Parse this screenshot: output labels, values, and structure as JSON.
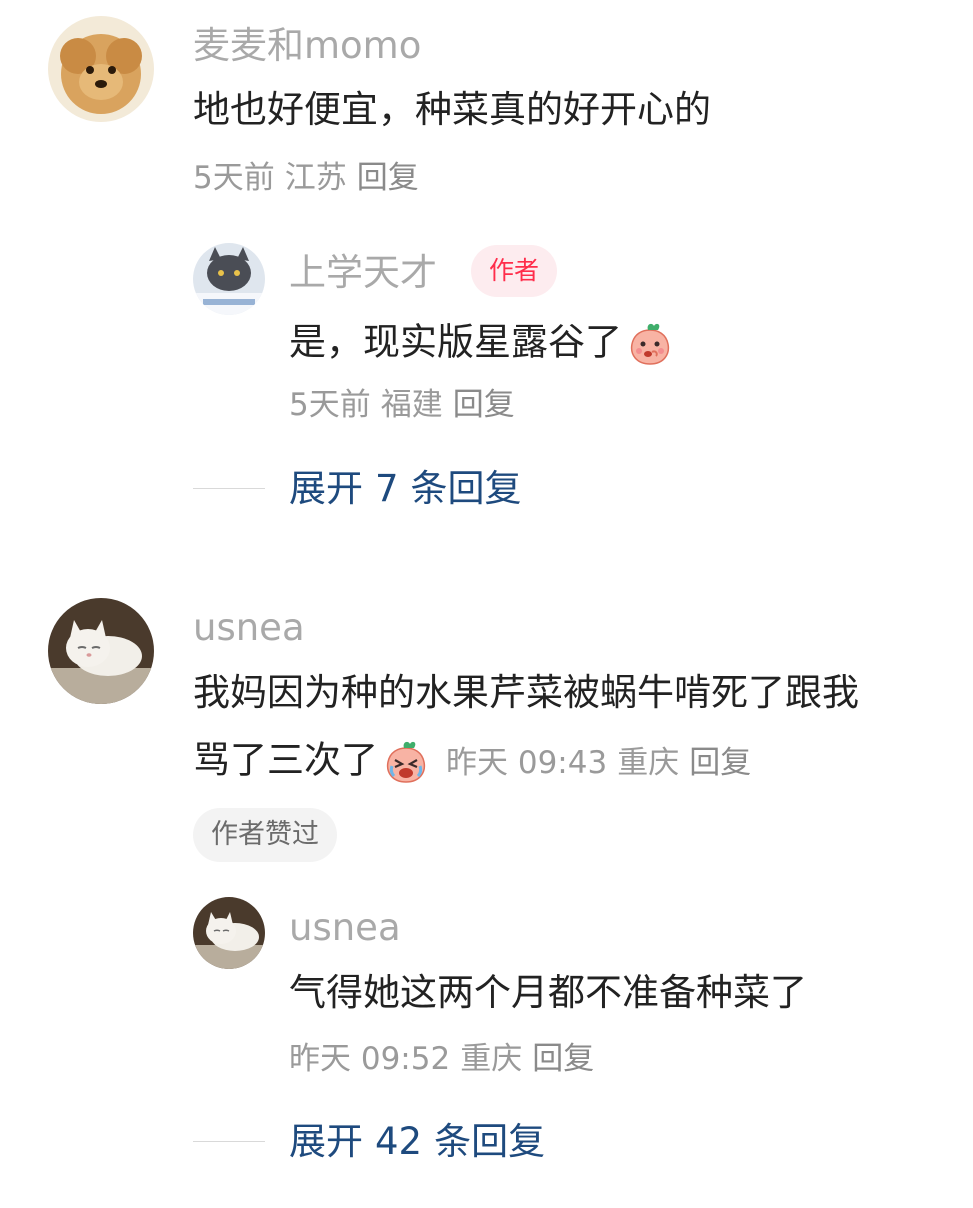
{
  "comments": [
    {
      "username": "麦麦和momo",
      "text": "地也好便宜，种菜真的好开心的",
      "time": "5天前",
      "location": "江苏",
      "reply_label": "回复",
      "avatar_icon": "dog-avatar",
      "reply": {
        "username": "上学天才",
        "badge": "作者",
        "text": "是，现实版星露谷了",
        "emoji_icon": "peach-smile-emoji",
        "time": "5天前",
        "location": "福建",
        "reply_label": "回复",
        "avatar_icon": "cat-avatar"
      },
      "expand": {
        "prefix": "展开",
        "count": "7",
        "suffix": "条回复"
      }
    },
    {
      "username": "usnea",
      "text_line1": "我妈因为种的水果芹菜被蜗牛啃死了跟我",
      "text_line2": "骂了三次了",
      "emoji_icon": "peach-crying-emoji",
      "time": "昨天 09:43",
      "location": "重庆",
      "reply_label": "回复",
      "liked_chip": "作者赞过",
      "avatar_icon": "white-cat-avatar",
      "reply": {
        "username": "usnea",
        "text": "气得她这两个月都不准备种菜了",
        "time": "昨天 09:52",
        "location": "重庆",
        "reply_label": "回复",
        "avatar_icon": "white-cat-avatar"
      },
      "expand": {
        "prefix": "展开",
        "count": "42",
        "suffix": "条回复"
      }
    }
  ],
  "colors": {
    "link": "#1e4a7e",
    "badge_text": "#ff2d4b",
    "badge_bg": "#fdecef",
    "muted": "#a9a9a9"
  }
}
